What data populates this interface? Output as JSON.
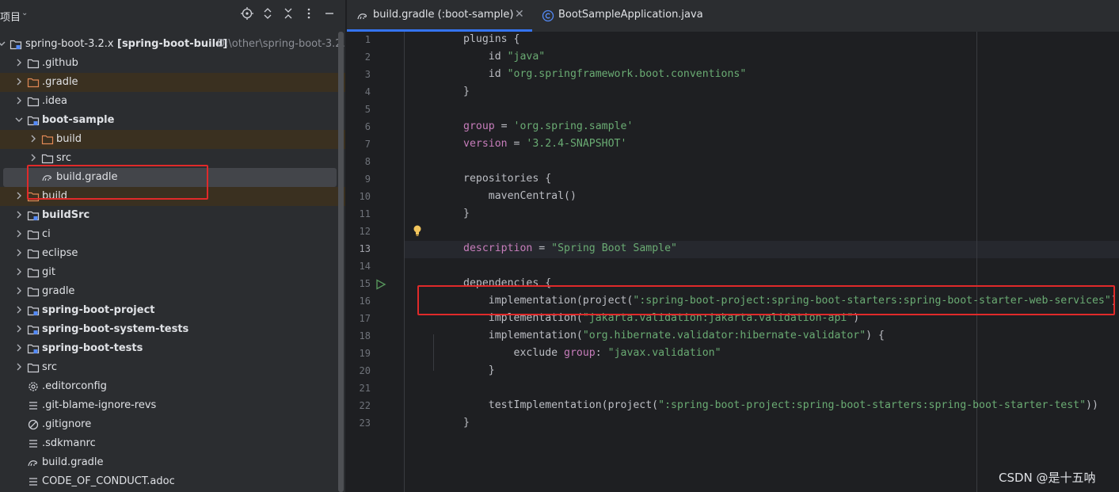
{
  "project_panel": {
    "title": "项目",
    "tree": [
      {
        "label": "spring-boot-3.2.x",
        "module": "[spring-boot-build]",
        "path": "D:\\other\\spring-boot-3.2.",
        "icon": "module-folder-icon"
      },
      {
        "label": ".github",
        "icon": "folder-icon"
      },
      {
        "label": ".gradle",
        "icon": "excluded-folder-icon"
      },
      {
        "label": ".idea",
        "icon": "folder-icon"
      },
      {
        "label": "boot-sample",
        "icon": "module-folder-icon"
      },
      {
        "label": "build",
        "icon": "excluded-folder-icon"
      },
      {
        "label": "src",
        "icon": "folder-icon"
      },
      {
        "label": "build.gradle",
        "icon": "gradle-icon"
      },
      {
        "label": "build",
        "icon": "excluded-folder-icon"
      },
      {
        "label": "buildSrc",
        "icon": "module-folder-icon"
      },
      {
        "label": "ci",
        "icon": "folder-icon"
      },
      {
        "label": "eclipse",
        "icon": "folder-icon"
      },
      {
        "label": "git",
        "icon": "folder-icon"
      },
      {
        "label": "gradle",
        "icon": "folder-icon"
      },
      {
        "label": "spring-boot-project",
        "icon": "module-folder-icon"
      },
      {
        "label": "spring-boot-system-tests",
        "icon": "module-folder-icon"
      },
      {
        "label": "spring-boot-tests",
        "icon": "module-folder-icon"
      },
      {
        "label": "src",
        "icon": "folder-icon"
      },
      {
        "label": ".editorconfig",
        "icon": "gear-file-icon"
      },
      {
        "label": ".git-blame-ignore-revs",
        "icon": "text-file-icon"
      },
      {
        "label": ".gitignore",
        "icon": "ignore-file-icon"
      },
      {
        "label": ".sdkmanrc",
        "icon": "text-file-icon"
      },
      {
        "label": "build.gradle",
        "icon": "gradle-icon"
      },
      {
        "label": "CODE_OF_CONDUCT.adoc",
        "icon": "text-file-icon"
      }
    ]
  },
  "editor": {
    "tabs": [
      {
        "label": "build.gradle (:boot-sample)",
        "active": true,
        "icon": "gradle-icon"
      },
      {
        "label": "BootSampleApplication.java",
        "active": false,
        "icon": "java-class-icon"
      }
    ],
    "current_line": 13,
    "line_numbers": [
      "1",
      "2",
      "3",
      "4",
      "5",
      "6",
      "7",
      "8",
      "9",
      "10",
      "11",
      "12",
      "13",
      "14",
      "15",
      "16",
      "17",
      "18",
      "19",
      "20",
      "21",
      "22",
      "23"
    ]
  },
  "watermark": "CSDN @是十五呐",
  "colors": {
    "accent": "#3574f0",
    "annotation": "#e02a2a",
    "string": "#6aab73",
    "keyword": "#cf8e6d",
    "property": "#c77dbb"
  }
}
